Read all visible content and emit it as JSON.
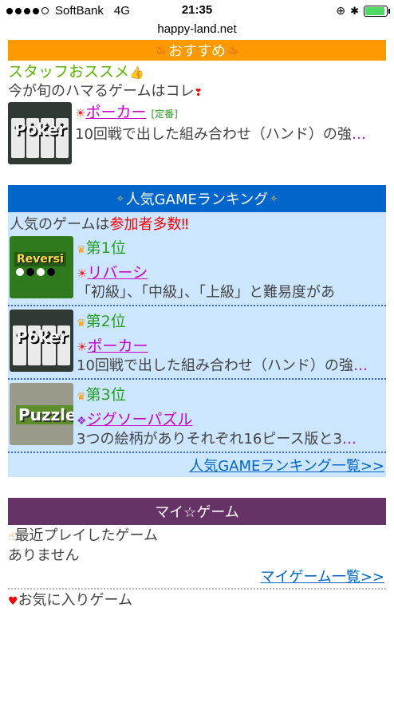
{
  "status": {
    "carrier": "SoftBank",
    "network": "4G",
    "time": "21:35",
    "battery_level": 0.9
  },
  "url": "happy-land.net",
  "recommend": {
    "bar_title": "おすすめ",
    "staff_label": "スタッフおススメ",
    "lead": "今が旬のハマるゲームはコレ",
    "game": {
      "thumb": "Poker",
      "title": "ポーカー",
      "tag": "[定番]",
      "desc": "10回戦で出した組み合わせ（ハンド）の強",
      "more": "…"
    }
  },
  "ranking": {
    "bar_title": "人気GAMEランキング",
    "lead_prefix": "人気のゲームは",
    "lead_highlight": "参加者多数",
    "items": [
      {
        "rank": "第1位",
        "thumb": "Reversi",
        "title": "リバーシ",
        "desc": "「初級」、「中級」、「上級」と難易度があ",
        "more": "…"
      },
      {
        "rank": "第2位",
        "thumb": "Poker",
        "title": "ポーカー",
        "desc": "10回戦で出した組み合わせ（ハンド）の強",
        "more": "…"
      },
      {
        "rank": "第3位",
        "thumb": "Puzzle",
        "title": "ジグソーパズル",
        "desc": "3つの絵柄がありそれぞれ16ピース版と3",
        "more": "…"
      }
    ],
    "more_link": "人気GAMEランキング一覧>>"
  },
  "mygame": {
    "bar_title": "マイ☆ゲーム",
    "recent_label": "最近プレイしたゲーム",
    "recent_empty": "ありません",
    "more_link": "マイゲーム一覧>>",
    "favorites_label": "お気に入りゲーム"
  }
}
